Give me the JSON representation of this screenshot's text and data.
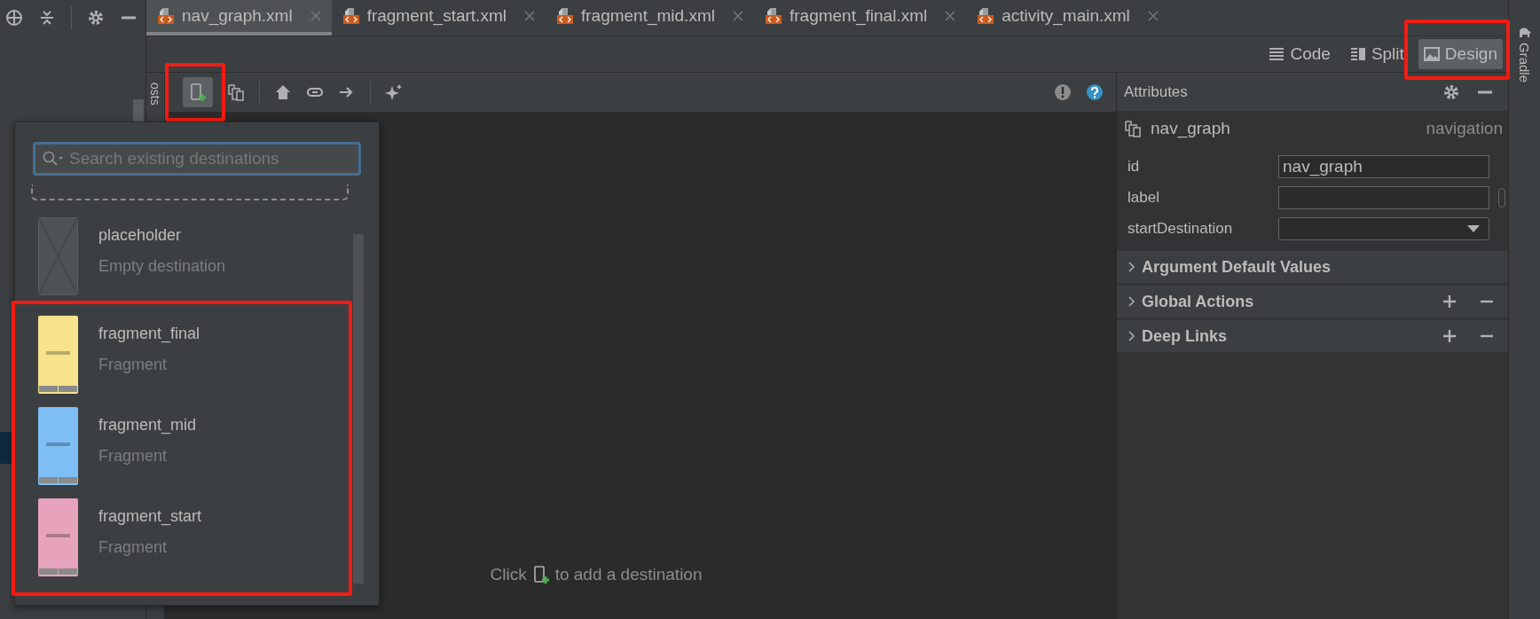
{
  "tabs": [
    {
      "label": "nav_graph.xml",
      "selected": true
    },
    {
      "label": "fragment_start.xml",
      "selected": false
    },
    {
      "label": "fragment_mid.xml",
      "selected": false
    },
    {
      "label": "fragment_final.xml",
      "selected": false
    },
    {
      "label": "activity_main.xml",
      "selected": false
    }
  ],
  "view_modes": [
    {
      "label": "Code",
      "selected": false,
      "highlighted": false
    },
    {
      "label": "Split",
      "selected": false,
      "highlighted": false
    },
    {
      "label": "Design",
      "selected": true,
      "highlighted": true
    }
  ],
  "side_tool": {
    "label": "Gradle"
  },
  "hosts_label": "osts",
  "add_destination": {
    "selected": true,
    "highlighted": true
  },
  "popup": {
    "search": {
      "placeholder": "Search existing destinations"
    },
    "destinations": [
      {
        "name": "placeholder",
        "type": "Empty destination",
        "kind": "placeholder",
        "highlighted": false
      },
      {
        "name": "fragment_final",
        "type": "Fragment",
        "kind": "fragment",
        "color": "#f6e38c",
        "highlighted": true
      },
      {
        "name": "fragment_mid",
        "type": "Fragment",
        "kind": "fragment",
        "color": "#7dbff5",
        "highlighted": true
      },
      {
        "name": "fragment_start",
        "type": "Fragment",
        "kind": "fragment",
        "color": "#e8a3bc",
        "highlighted": true
      }
    ]
  },
  "canvas": {
    "hint_before": "Click",
    "hint_after": "to add a destination"
  },
  "attributes": {
    "title": "Attributes",
    "component": {
      "name": "nav_graph",
      "type": "navigation"
    },
    "fields": [
      {
        "label": "id",
        "kind": "text",
        "value": "nav_graph"
      },
      {
        "label": "label",
        "kind": "resource"
      },
      {
        "label": "startDestination",
        "kind": "dropdown"
      }
    ],
    "sections": [
      {
        "title": "Argument Default Values",
        "expanded": false,
        "actions": false
      },
      {
        "title": "Global Actions",
        "expanded": false,
        "actions": true
      },
      {
        "title": "Deep Links",
        "expanded": false,
        "actions": true
      }
    ]
  }
}
